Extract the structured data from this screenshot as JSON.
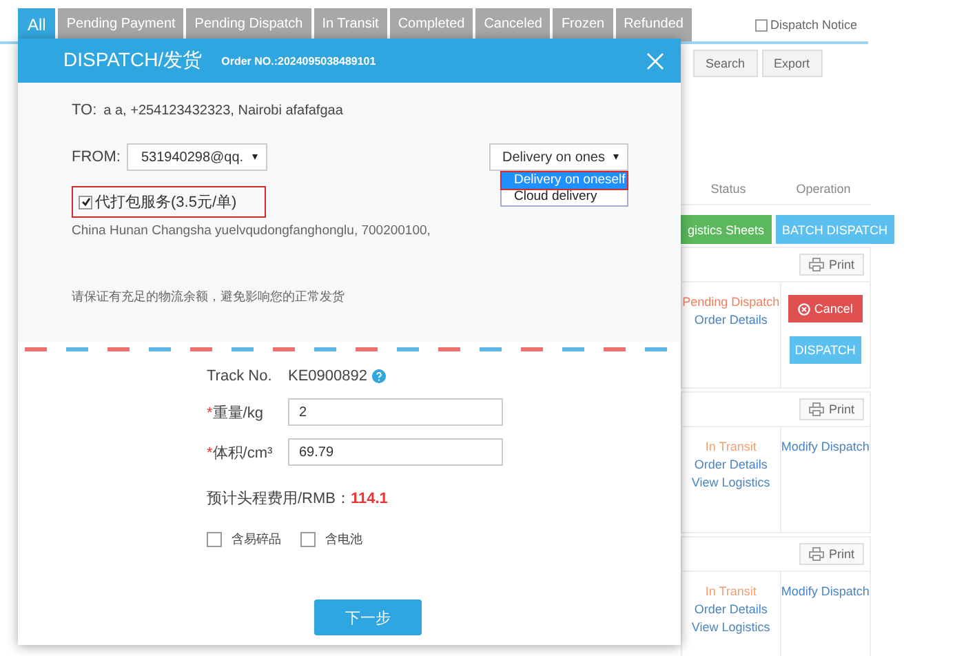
{
  "tabs": [
    {
      "label": "All",
      "selected": true
    },
    {
      "label": "Pending Payment",
      "selected": false
    },
    {
      "label": "Pending Dispatch",
      "selected": false
    },
    {
      "label": "In Transit",
      "selected": false
    },
    {
      "label": "Completed",
      "selected": false
    },
    {
      "label": "Canceled",
      "selected": false
    },
    {
      "label": "Frozen",
      "selected": false
    },
    {
      "label": "Refunded",
      "selected": false
    }
  ],
  "dispatch_notice": {
    "label": "Dispatch Notice",
    "checked": false
  },
  "toolbar_buttons": [
    "Search",
    "Export"
  ],
  "table": {
    "columns": [
      "Status",
      "Operation"
    ]
  },
  "bulk_buttons": [
    {
      "label": "gistics Sheets",
      "kind": "green"
    },
    {
      "label": "BATCH DISPATCH",
      "kind": "blue"
    }
  ],
  "orders": [
    {
      "print": "Print",
      "status": "Pending Dispatch",
      "color": "#f08060",
      "links": [
        "Order Details"
      ],
      "operations": [
        {
          "label": "Cancel",
          "kind": "cancel"
        },
        {
          "label": "DISPATCH",
          "kind": "dispatch"
        }
      ]
    },
    {
      "print": "Print",
      "status": "In Transit",
      "color": "#f0a070",
      "links": [
        "Order Details",
        "View Logistics"
      ],
      "operations": [
        {
          "label": "Modify Dispatch",
          "kind": "link"
        }
      ]
    },
    {
      "print": "Print",
      "status": "In Transit",
      "color": "#f0a070",
      "links": [
        "Order Details",
        "View Logistics"
      ],
      "operations": [
        {
          "label": "Modify Dispatch",
          "kind": "link"
        }
      ]
    }
  ],
  "dialog": {
    "title": "DISPATCH/发货",
    "order_no": "Order NO.:2024095038489101",
    "to_label": "TO:",
    "to": "a a, +254123432323, Nairobi afafafgaa",
    "from_label": "FROM:",
    "from_value": "531940298@qq.",
    "delivery_select": "Delivery on ones",
    "delivery_options": [
      {
        "label": "Delivery on oneself",
        "selected": true
      },
      {
        "label": "Cloud delivery",
        "selected": false
      }
    ],
    "packing_service": {
      "label": "代打包服务(3.5元/单)",
      "checked": true
    },
    "from_address": "China Hunan Changsha yuelvqudongfanghonglu, 700200100,",
    "notice": "请保证有充足的物流余额，避免影响您的正常发货",
    "track_label": "Track No.",
    "track_no": "KE0900892",
    "fields": [
      {
        "mark": "*",
        "label": "重量/kg",
        "value": "2"
      },
      {
        "mark": "*",
        "label": "体积/cm³",
        "value": "69.79"
      }
    ],
    "cost_label": "预计头程费用/RMB：",
    "cost": "114.1",
    "options": [
      {
        "label": "含易碎品",
        "checked": false
      },
      {
        "label": "含电池",
        "checked": false
      }
    ],
    "next_button": "下一步"
  }
}
